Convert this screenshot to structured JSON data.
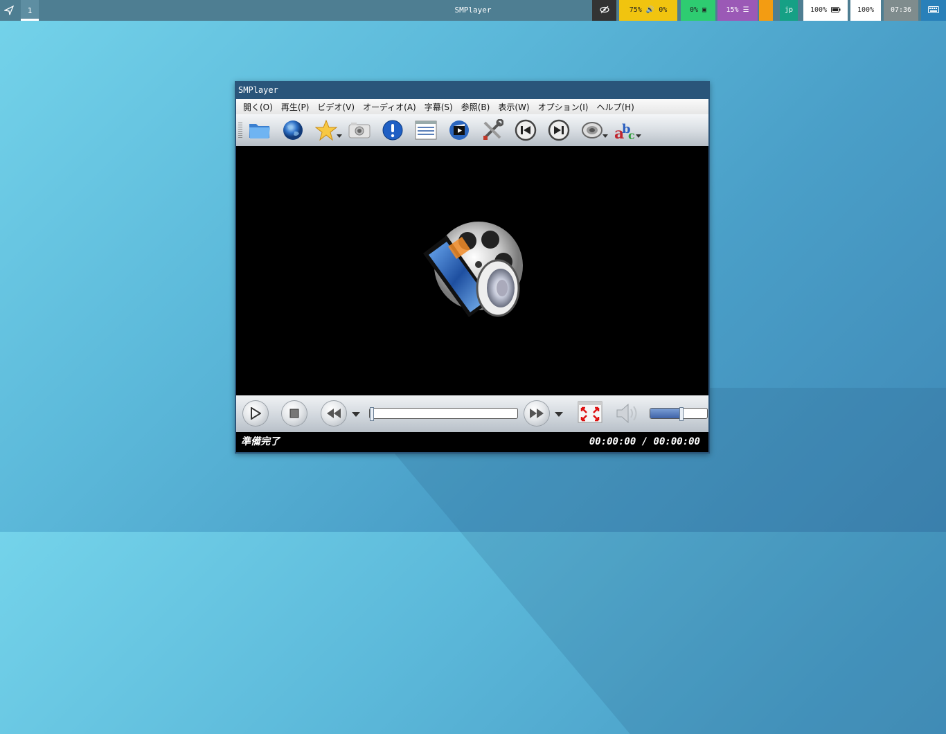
{
  "panel": {
    "workspace": "1",
    "title": "SMPlayer",
    "volume": "75%",
    "volume_extra": "0%",
    "cpu": "0%",
    "memory": "15%",
    "language": "jp",
    "battery": "100%",
    "brightness": "100%",
    "clock": "07:36"
  },
  "window": {
    "title": "SMPlayer",
    "menu": [
      "開く(O)",
      "再生(P)",
      "ビデオ(V)",
      "オーディオ(A)",
      "字幕(S)",
      "参照(B)",
      "表示(W)",
      "オプション(I)",
      "ヘルプ(H)"
    ],
    "toolbar_icons": [
      "open-folder-icon",
      "open-url-globe-icon",
      "favorites-star-icon",
      "screenshot-camera-icon",
      "info-icon",
      "playlist-icon",
      "mplayer-log-icon",
      "preferences-tools-icon",
      "previous-icon",
      "next-icon",
      "audio-track-icon",
      "subtitles-abc-icon"
    ],
    "status_text": "準備完了",
    "time_display": "00:00:00 / 00:00:00",
    "seek_progress": 0,
    "volume_level": 0.55
  },
  "colors": {
    "panel_bg": "#4e7e92",
    "window_frame": "#2a557a",
    "video_bg": "#000000"
  }
}
